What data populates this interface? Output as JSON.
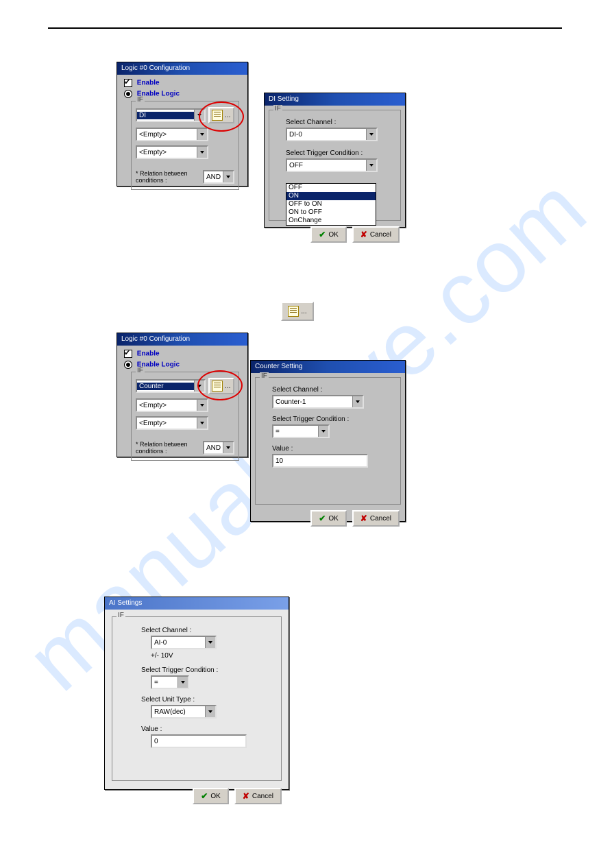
{
  "watermark": "manualshive.com",
  "logicDialog1": {
    "title": "Logic #0 Configuration",
    "enable": "Enable",
    "enableLogic": "Enable Logic",
    "ifLabel": "IF",
    "cond1": "DI",
    "cond2": "<Empty>",
    "cond3": "<Empty>",
    "relation": "* Relation between conditions :",
    "relationVal": "AND"
  },
  "diSetting": {
    "title": "DI Setting",
    "ifLabel": "IF",
    "selChannel": "Select Channel :",
    "channelVal": "DI-0",
    "selTrigger": "Select Trigger Condition :",
    "triggerVal": "OFF",
    "options": [
      "OFF",
      "ON",
      "OFF to ON",
      "ON to OFF",
      "OnChange"
    ],
    "ok": "OK",
    "cancel": "Cancel"
  },
  "logicDialog2": {
    "title": "Logic #0 Configuration",
    "enable": "Enable",
    "enableLogic": "Enable Logic",
    "ifLabel": "IF",
    "cond1": "Counter",
    "cond2": "<Empty>",
    "cond3": "<Empty>",
    "relation": "* Relation between conditions :",
    "relationVal": "AND"
  },
  "counterSetting": {
    "title": "Counter Setting",
    "ifLabel": "IF",
    "selChannel": "Select Channel :",
    "channelVal": "Counter-1",
    "selTrigger": "Select Trigger Condition :",
    "triggerVal": "=",
    "valueLabel": "Value :",
    "value": "10",
    "ok": "OK",
    "cancel": "Cancel"
  },
  "aiSetting": {
    "title": "AI Settings",
    "ifLabel": "IF",
    "selChannel": "Select Channel :",
    "channelVal": "AI-0",
    "range": "+/- 10V",
    "selTrigger": "Select Trigger Condition :",
    "triggerVal": "=",
    "selUnit": "Select Unit Type :",
    "unitVal": "RAW(dec)",
    "valueLabel": "Value :",
    "value": "0",
    "ok": "OK",
    "cancel": "Cancel"
  }
}
